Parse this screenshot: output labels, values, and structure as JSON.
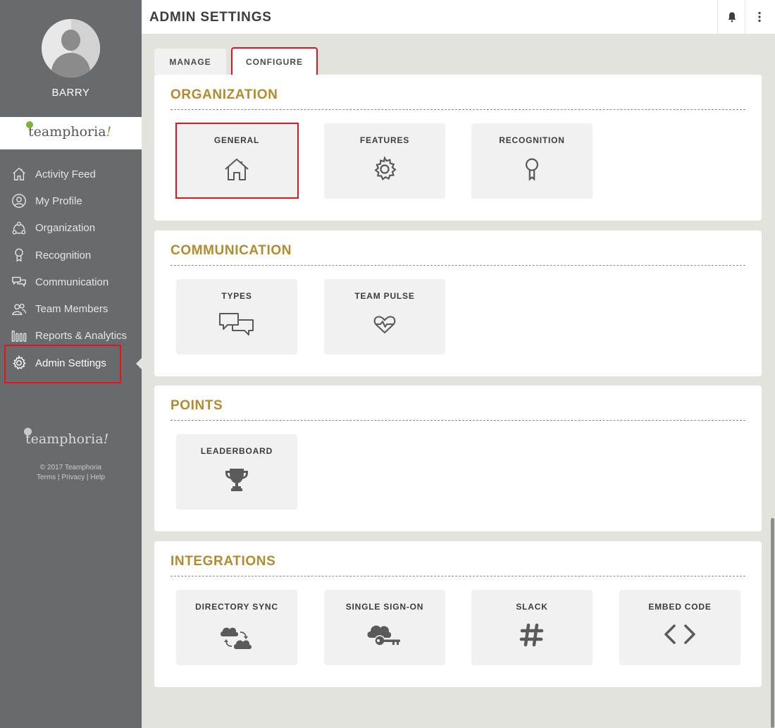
{
  "user": {
    "name": "BARRY"
  },
  "brand": {
    "logo_text": "teamphoria",
    "logo_bang": "!",
    "accent": "#b48a2c",
    "highlight": "#e3141b"
  },
  "sidebar": {
    "items": [
      {
        "label": "Activity Feed",
        "icon": "home-icon"
      },
      {
        "label": "My Profile",
        "icon": "user-circle-icon"
      },
      {
        "label": "Organization",
        "icon": "organization-icon"
      },
      {
        "label": "Recognition",
        "icon": "ribbon-icon"
      },
      {
        "label": "Communication",
        "icon": "chat-bubbles-icon"
      },
      {
        "label": "Team Members",
        "icon": "team-icon"
      },
      {
        "label": "Reports & Analytics",
        "icon": "bars-icon"
      },
      {
        "label": "Admin Settings",
        "icon": "gear-icon"
      }
    ],
    "footer": {
      "copyright": "© 2017 Teamphoria",
      "links": "Terms | Privacy | Help"
    }
  },
  "header": {
    "title": "ADMIN SETTINGS"
  },
  "tabs": [
    {
      "label": "MANAGE"
    },
    {
      "label": "CONFIGURE"
    }
  ],
  "sections": [
    {
      "title": "ORGANIZATION",
      "tiles": [
        {
          "label": "GENERAL",
          "icon": "house-icon"
        },
        {
          "label": "FEATURES",
          "icon": "gear-icon"
        },
        {
          "label": "RECOGNITION",
          "icon": "award-ribbon-icon"
        }
      ]
    },
    {
      "title": "COMMUNICATION",
      "tiles": [
        {
          "label": "TYPES",
          "icon": "chat-bubbles-icon"
        },
        {
          "label": "TEAM PULSE",
          "icon": "heart-pulse-icon"
        }
      ]
    },
    {
      "title": "POINTS",
      "tiles": [
        {
          "label": "LEADERBOARD",
          "icon": "trophy-icon"
        }
      ]
    },
    {
      "title": "INTEGRATIONS",
      "tiles": [
        {
          "label": "DIRECTORY SYNC",
          "icon": "cloud-sync-icon"
        },
        {
          "label": "SINGLE SIGN-ON",
          "icon": "cloud-key-icon"
        },
        {
          "label": "SLACK",
          "icon": "hashtag-icon"
        },
        {
          "label": "EMBED CODE",
          "icon": "code-brackets-icon"
        }
      ]
    }
  ]
}
